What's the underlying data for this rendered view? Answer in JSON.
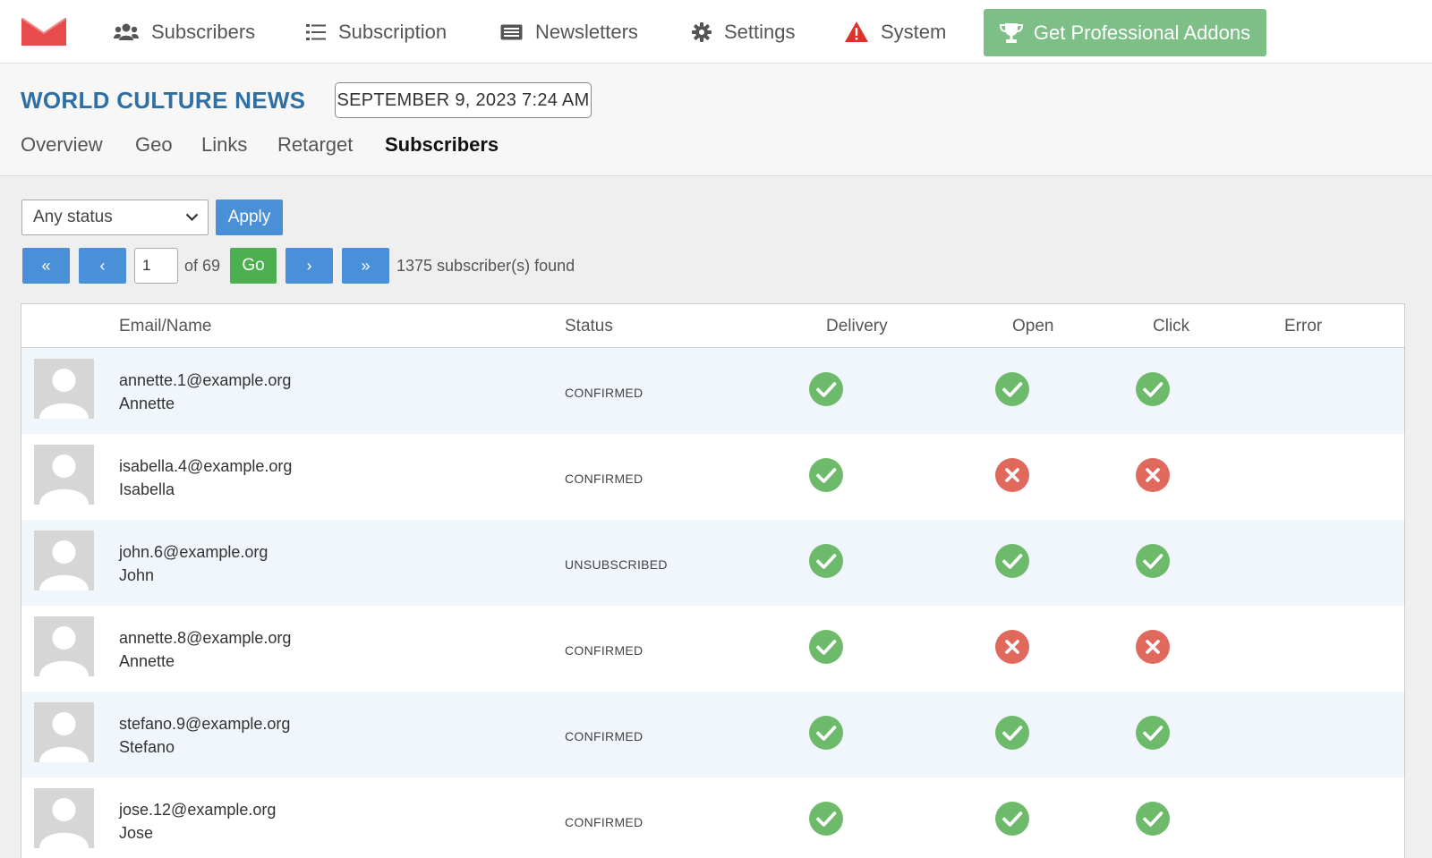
{
  "nav": {
    "items": [
      {
        "label": "Subscribers",
        "icon": "users-icon"
      },
      {
        "label": "Subscription",
        "icon": "list-icon"
      },
      {
        "label": "Newsletters",
        "icon": "newspaper-icon"
      },
      {
        "label": "Settings",
        "icon": "gear-icon"
      },
      {
        "label": "System",
        "icon": "warning-icon"
      }
    ],
    "addons_label": "Get Professional Addons",
    "logo_color": "#e64c4c"
  },
  "newsletter": {
    "title": "WORLD CULTURE NEWS",
    "date": "SEPTEMBER 9, 2023 7:24 AM"
  },
  "tabs": [
    "Overview",
    "Geo",
    "Links",
    "Retarget",
    "Subscribers"
  ],
  "active_tab": "Subscribers",
  "filters": {
    "status_selected": "Any status",
    "apply_label": "Apply"
  },
  "pagination": {
    "first": "«",
    "prev": "‹",
    "next": "›",
    "last": "»",
    "current_page": "1",
    "of_text": "of 69",
    "go_label": "Go",
    "found_text": "1375 subscriber(s) found"
  },
  "table": {
    "columns": [
      "Email/Name",
      "Status",
      "Delivery",
      "Open",
      "Click",
      "Error"
    ],
    "rows": [
      {
        "email": "annette.1@example.org",
        "name": "Annette",
        "status": "CONFIRMED",
        "delivery": true,
        "open": true,
        "click": true
      },
      {
        "email": "isabella.4@example.org",
        "name": "Isabella",
        "status": "CONFIRMED",
        "delivery": true,
        "open": false,
        "click": false
      },
      {
        "email": "john.6@example.org",
        "name": "John",
        "status": "UNSUBSCRIBED",
        "delivery": true,
        "open": true,
        "click": true
      },
      {
        "email": "annette.8@example.org",
        "name": "Annette",
        "status": "CONFIRMED",
        "delivery": true,
        "open": false,
        "click": false
      },
      {
        "email": "stefano.9@example.org",
        "name": "Stefano",
        "status": "CONFIRMED",
        "delivery": true,
        "open": true,
        "click": true
      },
      {
        "email": "jose.12@example.org",
        "name": "Jose",
        "status": "CONFIRMED",
        "delivery": true,
        "open": true,
        "click": true
      }
    ]
  },
  "colors": {
    "accent_blue": "#4a90d9",
    "title_blue": "#2f6fa4",
    "success_green": "#6dbb6a",
    "error_red": "#e0685c",
    "addons_green": "#7dbf86"
  }
}
